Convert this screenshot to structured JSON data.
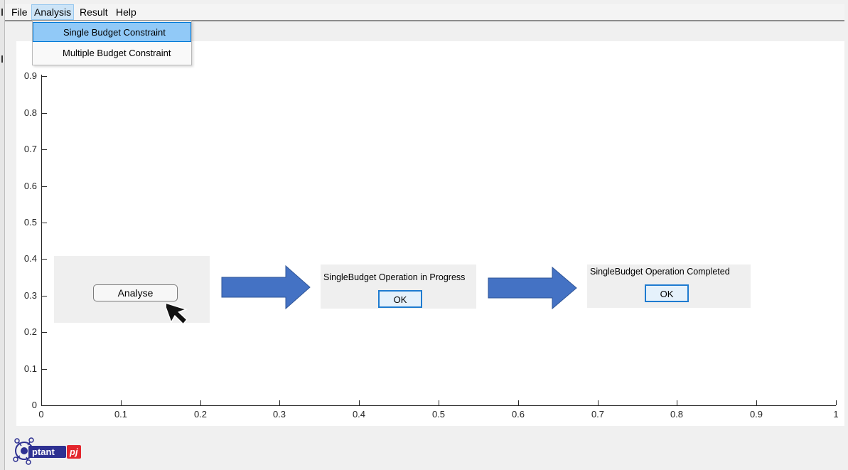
{
  "menubar": {
    "items": [
      "File",
      "Analysis",
      "Result",
      "Help"
    ]
  },
  "analysis_menu": {
    "items": [
      "Single Budget Constraint",
      "Multiple Budget Constraint"
    ]
  },
  "axes": {
    "y_ticks": [
      "0",
      "0.1",
      "0.2",
      "0.3",
      "0.4",
      "0.5",
      "0.6",
      "0.7",
      "0.8",
      "0.9"
    ],
    "x_ticks": [
      "0",
      "0.1",
      "0.2",
      "0.3",
      "0.4",
      "0.5",
      "0.6",
      "0.7",
      "0.8",
      "0.9",
      "1"
    ]
  },
  "steps": {
    "analyse_label": "Analyse",
    "progress_message": "SingleBudget Operation in Progress",
    "progress_ok": "OK",
    "complete_message": "SingleBudget Operation Completed",
    "complete_ok": "OK"
  },
  "logo": {
    "text_main": "ptant",
    "text_badge": "pj"
  },
  "colors": {
    "arrow_fill": "#4472c4",
    "menu_highlight": "#91c9f7",
    "ok_border": "#1e7bd0",
    "logo_blue": "#2e3192",
    "logo_red": "#e3262d"
  }
}
